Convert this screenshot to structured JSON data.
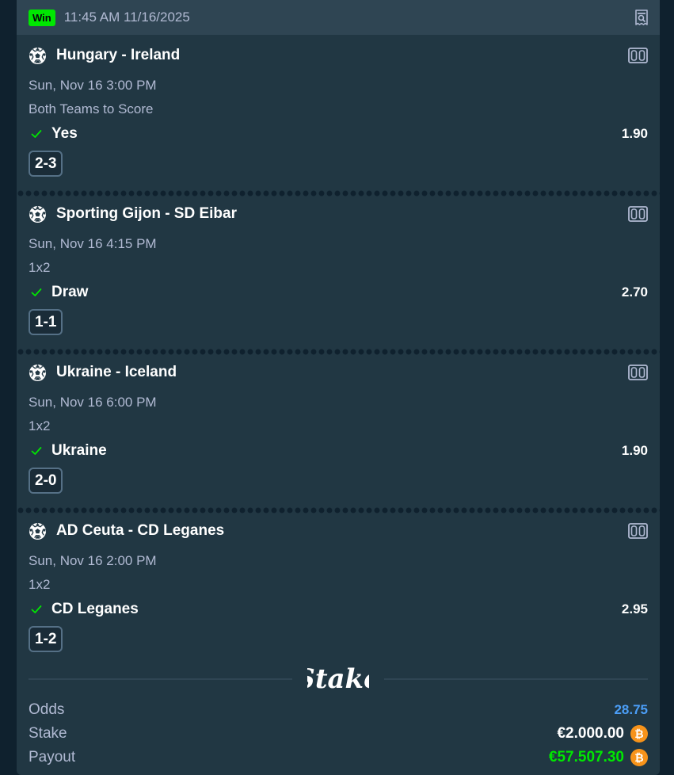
{
  "header": {
    "status_badge": "Win",
    "timestamp": "11:45 AM 11/16/2025",
    "icon": "receipt-search-icon"
  },
  "legs": [
    {
      "title": "Hungary - Ireland",
      "date": "Sun, Nov 16  3:00 PM",
      "market": "Both Teams to Score",
      "pick": "Yes",
      "odds": "1.90",
      "score": "2-3"
    },
    {
      "title": "Sporting Gijon - SD Eibar",
      "date": "Sun, Nov 16  4:15 PM",
      "market": "1x2",
      "pick": "Draw",
      "odds": "2.70",
      "score": "1-1"
    },
    {
      "title": "Ukraine - Iceland",
      "date": "Sun, Nov 16  6:00 PM",
      "market": "1x2",
      "pick": "Ukraine",
      "odds": "1.90",
      "score": "2-0"
    },
    {
      "title": "AD Ceuta - CD Leganes",
      "date": "Sun, Nov 16  2:00 PM",
      "market": "1x2",
      "pick": "CD Leganes",
      "odds": "2.95",
      "score": "1-2"
    }
  ],
  "summary": {
    "logo_text": "Stake",
    "odds_label": "Odds",
    "odds_value": "28.75",
    "stake_label": "Stake",
    "stake_value": "€2.000.00",
    "payout_label": "Payout",
    "payout_value": "€57.507.30"
  },
  "colors": {
    "win": "#00e701",
    "odds_accent": "#4b9ef7",
    "bitcoin": "#f7931a",
    "card": "#213743",
    "header": "#2f4553"
  }
}
